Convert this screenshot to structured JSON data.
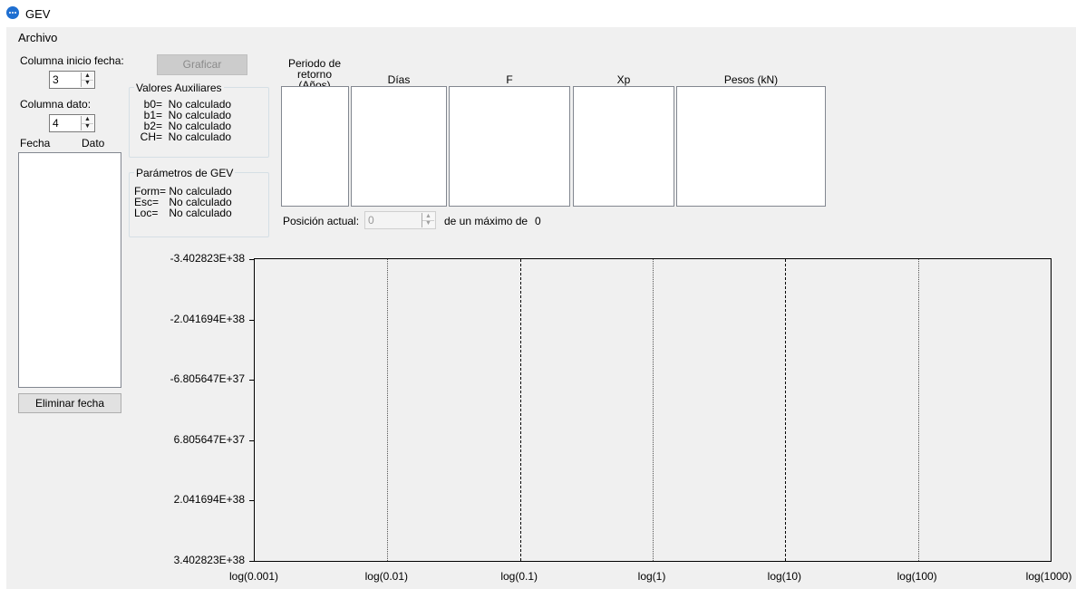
{
  "window": {
    "title": "GEV"
  },
  "menu": {
    "items": [
      "Archivo"
    ]
  },
  "left": {
    "start_col_label": "Columna inicio fecha:",
    "start_col_value": "3",
    "data_col_label": "Columna dato:",
    "data_col_value": "4",
    "list_headers": [
      "Fecha",
      "Dato"
    ],
    "delete_button": "Eliminar fecha"
  },
  "graph_button": "Graficar",
  "aux": {
    "title": "Valores Auxiliares",
    "items": [
      {
        "key": "b0=",
        "value": "No calculado"
      },
      {
        "key": "b1=",
        "value": "No calculado"
      },
      {
        "key": "b2=",
        "value": "No calculado"
      },
      {
        "key": "CH=",
        "value": "No calculado"
      }
    ]
  },
  "gev": {
    "title": "Parámetros de GEV",
    "items": [
      {
        "key": "Form=",
        "value": "No calculado"
      },
      {
        "key": "Esc=",
        "value": "No calculado"
      },
      {
        "key": "Loc=",
        "value": "No calculado"
      }
    ]
  },
  "table": {
    "headers": [
      "Periodo de retorno (Años)",
      "Días",
      "F",
      "Xp",
      "Pesos (kN)"
    ],
    "header_line1": "Periodo de",
    "header_line2": "retorno (Años)"
  },
  "position": {
    "label": "Posición actual:",
    "value": "0",
    "max_label": "de un máximo de",
    "max_value": "0"
  },
  "chart_data": {
    "type": "line",
    "title": "",
    "xlabel": "",
    "ylabel": "",
    "x_scale": "log",
    "x_tick_labels": [
      "log(0.001)",
      "log(0.01)",
      "log(0.1)",
      "log(1)",
      "log(10)",
      "log(100)",
      "log(1000)"
    ],
    "y_tick_labels": [
      "-3.402823E+38",
      "-2.041694E+38",
      "-6.805647E+37",
      "6.805647E+37",
      "2.041694E+38",
      "3.402823E+38"
    ],
    "ylim": [
      -3.402823e+38,
      3.402823e+38
    ],
    "series": [],
    "grid": "vertical"
  }
}
